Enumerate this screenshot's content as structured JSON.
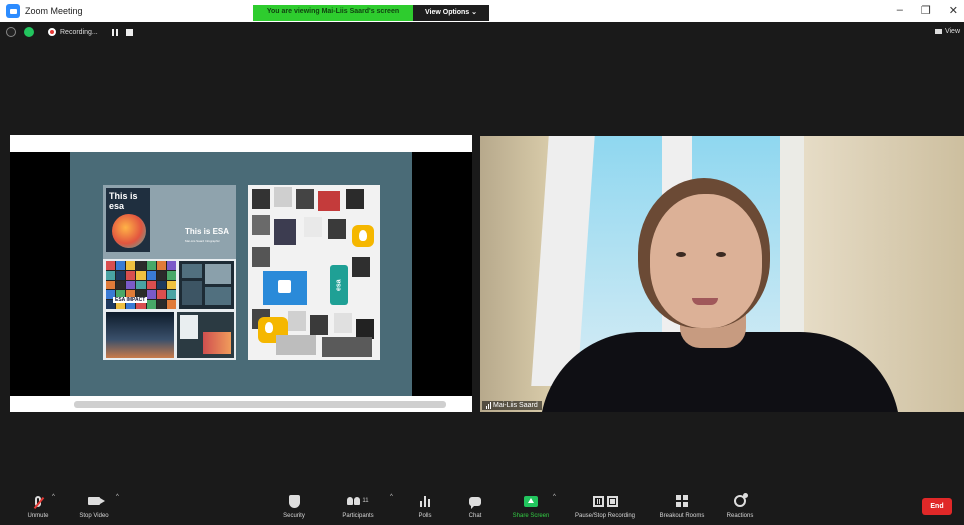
{
  "window": {
    "title": "Zoom Meeting",
    "controls": [
      "–",
      "❐",
      "✕"
    ]
  },
  "share_banner": {
    "message": "You are viewing Mai-Liis Saard's screen",
    "view_options": "View Options ⌄"
  },
  "meeting_bar": {
    "recording_label": "Recording...",
    "view_label": "View"
  },
  "slide": {
    "poster_label": "This is esa",
    "title": "This is ESA",
    "subtitle": "Mai-Liis Saard Infographic",
    "impact_label": "ESA IMPACT",
    "tag": "esa"
  },
  "participant": {
    "name": "Mai-Liis Saard"
  },
  "toolbar": {
    "unmute": "Unmute",
    "stop_video": "Stop Video",
    "security": "Security",
    "participants": "Participants",
    "participants_count": "11",
    "polls": "Polls",
    "chat": "Chat",
    "share_screen": "Share Screen",
    "pause_stop_recording": "Pause/Stop Recording",
    "breakout_rooms": "Breakout Rooms",
    "reactions": "Reactions",
    "end": "End",
    "caret": "^"
  },
  "colors": {
    "accent_green": "#2ecc2e",
    "end_red": "#e02828",
    "share_green": "#22c55e"
  }
}
